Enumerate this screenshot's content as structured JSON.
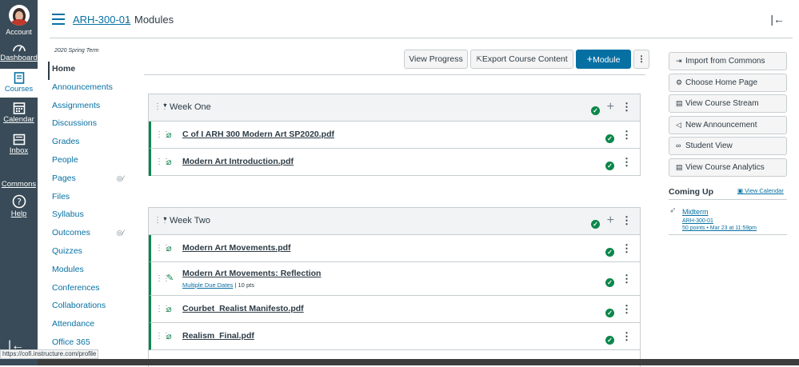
{
  "global_nav": {
    "account": "Account",
    "dashboard": "Dashboard",
    "courses": "Courses",
    "calendar": "Calendar",
    "inbox": "Inbox",
    "commons": "Commons",
    "help": "Help"
  },
  "header": {
    "course": "ARH-300-01",
    "separator": "›",
    "page": "Modules"
  },
  "course_nav": {
    "term": "2020 Spring Term",
    "items": [
      "Home",
      "Announcements",
      "Assignments",
      "Discussions",
      "Grades",
      "People",
      "Pages",
      "Files",
      "Syllabus",
      "Outcomes",
      "Quizzes",
      "Modules",
      "Conferences",
      "Collaborations",
      "Attendance",
      "Office 365"
    ]
  },
  "toolbar": {
    "view_progress": "View Progress",
    "export": "Export Course Content",
    "add_module": "Module"
  },
  "modules": [
    {
      "title": "Week One",
      "items": [
        {
          "title": "C of I ARH 300 Modern Art SP2020.pdf",
          "type": "attachment"
        },
        {
          "title": "Modern Art Introduction.pdf",
          "type": "attachment"
        }
      ]
    },
    {
      "title": "Week Two",
      "items": [
        {
          "title": "Modern Art Movements.pdf",
          "type": "attachment"
        },
        {
          "title": "Modern Art Movements: Reflection",
          "type": "assignment",
          "due": "Multiple Due Dates",
          "points": "10 pts"
        },
        {
          "title": "Courbet_Realist Manifesto.pdf",
          "type": "attachment"
        },
        {
          "title": "Realism_Final.pdf",
          "type": "attachment"
        }
      ]
    }
  ],
  "sidebar": {
    "buttons": [
      "Import from Commons",
      "Choose Home Page",
      "View Course Stream",
      "New Announcement",
      "Student View",
      "View Course Analytics"
    ],
    "coming_up": "Coming Up",
    "view_calendar": "View Calendar",
    "event": {
      "title": "Midterm",
      "course": "ARH-300-01",
      "detail": "50 points • Mar 23 at 11:59pm"
    }
  },
  "status_url": "https://cofi.instructure.com/profile",
  "colors": {
    "nav_bg": "#394b58",
    "link": "#0770a3",
    "primary": "#0770a3",
    "success": "#0b874b"
  }
}
